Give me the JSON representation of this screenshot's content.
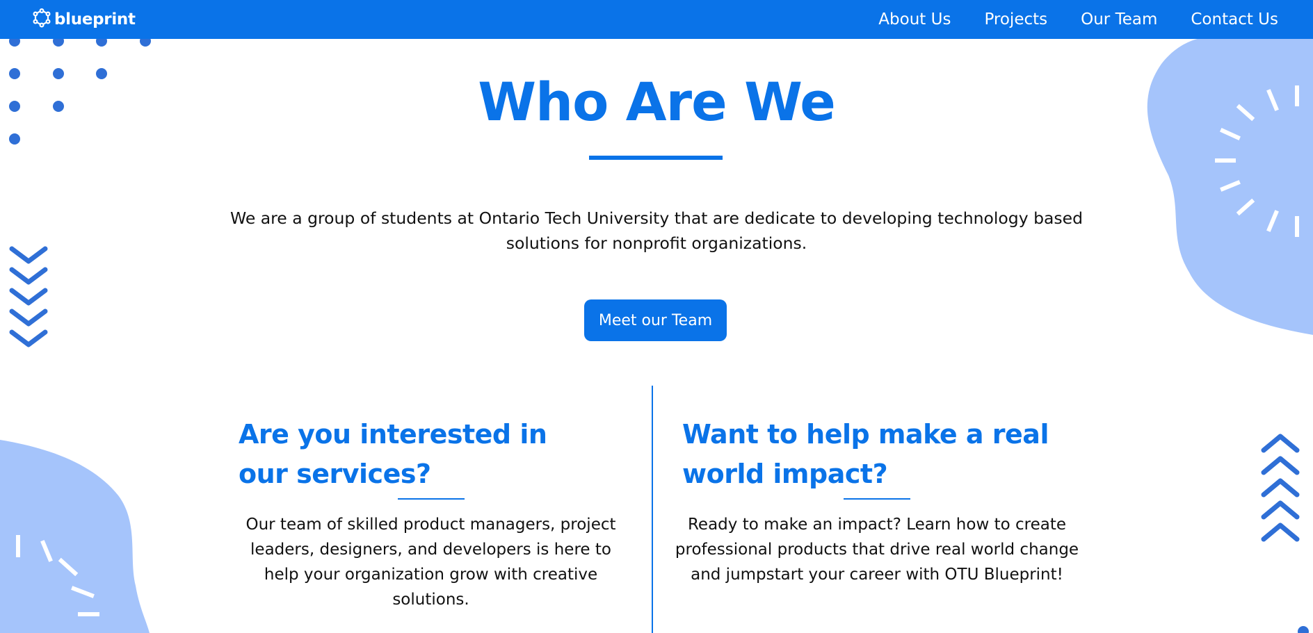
{
  "brand": {
    "name": "blueprint",
    "logo_icon": "blueprint-logo-icon"
  },
  "nav": {
    "links": [
      "About Us",
      "Projects",
      "Our Team",
      "Contact Us"
    ]
  },
  "hero": {
    "title": "Who Are We",
    "description": "We are a group of students at Ontario Tech University that are dedicate to developing technology based solutions for nonprofit organizations.",
    "cta_label": "Meet our Team"
  },
  "sections": [
    {
      "title": "Are you interested in our services?",
      "text": "Our team of skilled product managers, project leaders, designers, and developers is here to help your organization grow with creative solutions."
    },
    {
      "title": "Want to help make a real world impact?",
      "text": "Ready to make an impact? Learn how to create professional products that drive real world change and jumpstart your career with OTU Blueprint!"
    }
  ],
  "colors": {
    "primary": "#0a73e8",
    "blob": "#a5c4fb",
    "dots": "#2f6fd6",
    "background": "#ffffff"
  },
  "icons": [
    "blueprint-logo-icon",
    "dot-pattern",
    "chevron-down-stack-icon",
    "chevron-up-stack-icon",
    "sunburst-decoration"
  ]
}
